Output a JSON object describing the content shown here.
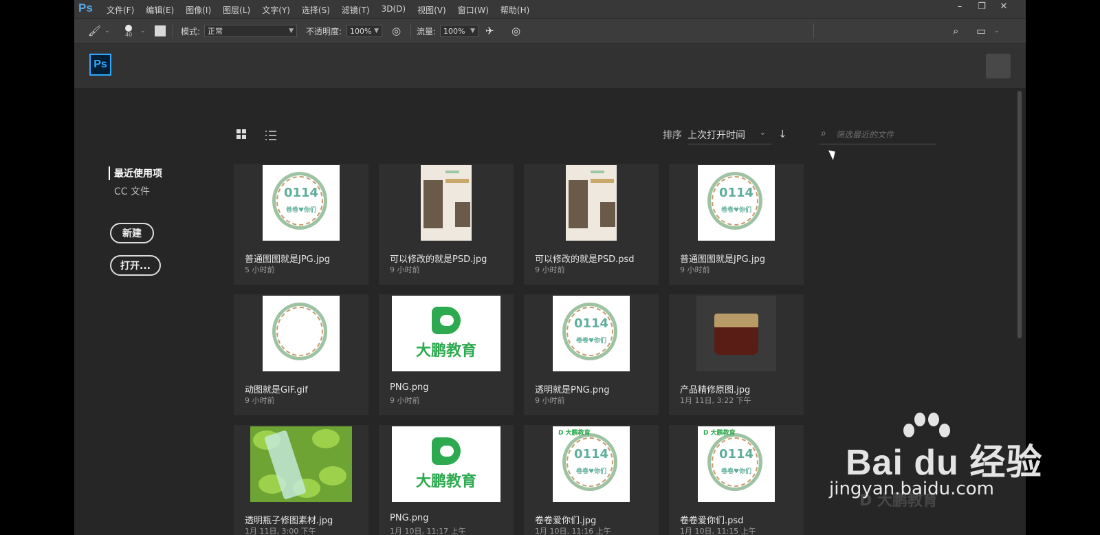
{
  "menubar": {
    "app": "Ps",
    "items": [
      "文件(F)",
      "编辑(E)",
      "图像(I)",
      "图层(L)",
      "文字(Y)",
      "选择(S)",
      "滤镜(T)",
      "3D(D)",
      "视图(V)",
      "窗口(W)",
      "帮助(H)"
    ],
    "window_controls": [
      "minimize-icon",
      "restore-icon",
      "close-icon"
    ]
  },
  "options": {
    "brush_size": "40",
    "mode_label": "模式:",
    "mode_value": "正常",
    "opacity_label": "不透明度:",
    "opacity_value": "100%",
    "flow_label": "流量:",
    "flow_value": "100%"
  },
  "header": {
    "logo": "Ps"
  },
  "sidebar": {
    "recent": "最近使用项",
    "cc_files": "CC 文件",
    "new_button": "新建",
    "open_button": "打开..."
  },
  "toolbar": {
    "sort_label": "排序",
    "sort_value": "上次打开时间",
    "filter_placeholder": "筛选最近的文件"
  },
  "files": [
    {
      "name": "普通图图就是JPG.jpg",
      "time": "5 小时前",
      "thumb": "wreath"
    },
    {
      "name": "可以修改的就是PSD.jpg",
      "time": "9 小时前",
      "thumb": "deer"
    },
    {
      "name": "可以修改的就是PSD.psd",
      "time": "9 小时前",
      "thumb": "deer"
    },
    {
      "name": "普通图图就是JPG.jpg",
      "time": "9 小时前",
      "thumb": "wreath"
    },
    {
      "name": "动图就是GIF.gif",
      "time": "9 小时前",
      "thumb": "wreath-blank"
    },
    {
      "name": "PNG.png",
      "time": "9 小时前",
      "thumb": "logo"
    },
    {
      "name": "透明就是PNG.png",
      "time": "9 小时前",
      "thumb": "wreath"
    },
    {
      "name": "产品精修原图.jpg",
      "time": "1月 11日, 3:22 下午",
      "thumb": "cream"
    },
    {
      "name": "透明瓶子修图素材.jpg",
      "time": "1月 11日, 3:00 下午",
      "thumb": "leaves"
    },
    {
      "name": "PNG.png",
      "time": "1月 10日, 11:17 上午",
      "thumb": "logo"
    },
    {
      "name": "卷卷爱你们.jpg",
      "time": "1月 10日, 11:16 上午",
      "thumb": "wreath-tag"
    },
    {
      "name": "卷卷爱你们.psd",
      "time": "1月 10日, 11:15 上午",
      "thumb": "wreath-tag"
    }
  ],
  "thumb_text": {
    "wreath_number": "0114",
    "wreath_subtitle": "卷卷♥你们",
    "wreath_tag": "D 大鹏教育",
    "logo_text": "大鹏教育"
  },
  "watermark": {
    "brand": "Bai du 经验",
    "url": "jingyan.baidu.com",
    "overlay": "D 大鹏教育"
  }
}
